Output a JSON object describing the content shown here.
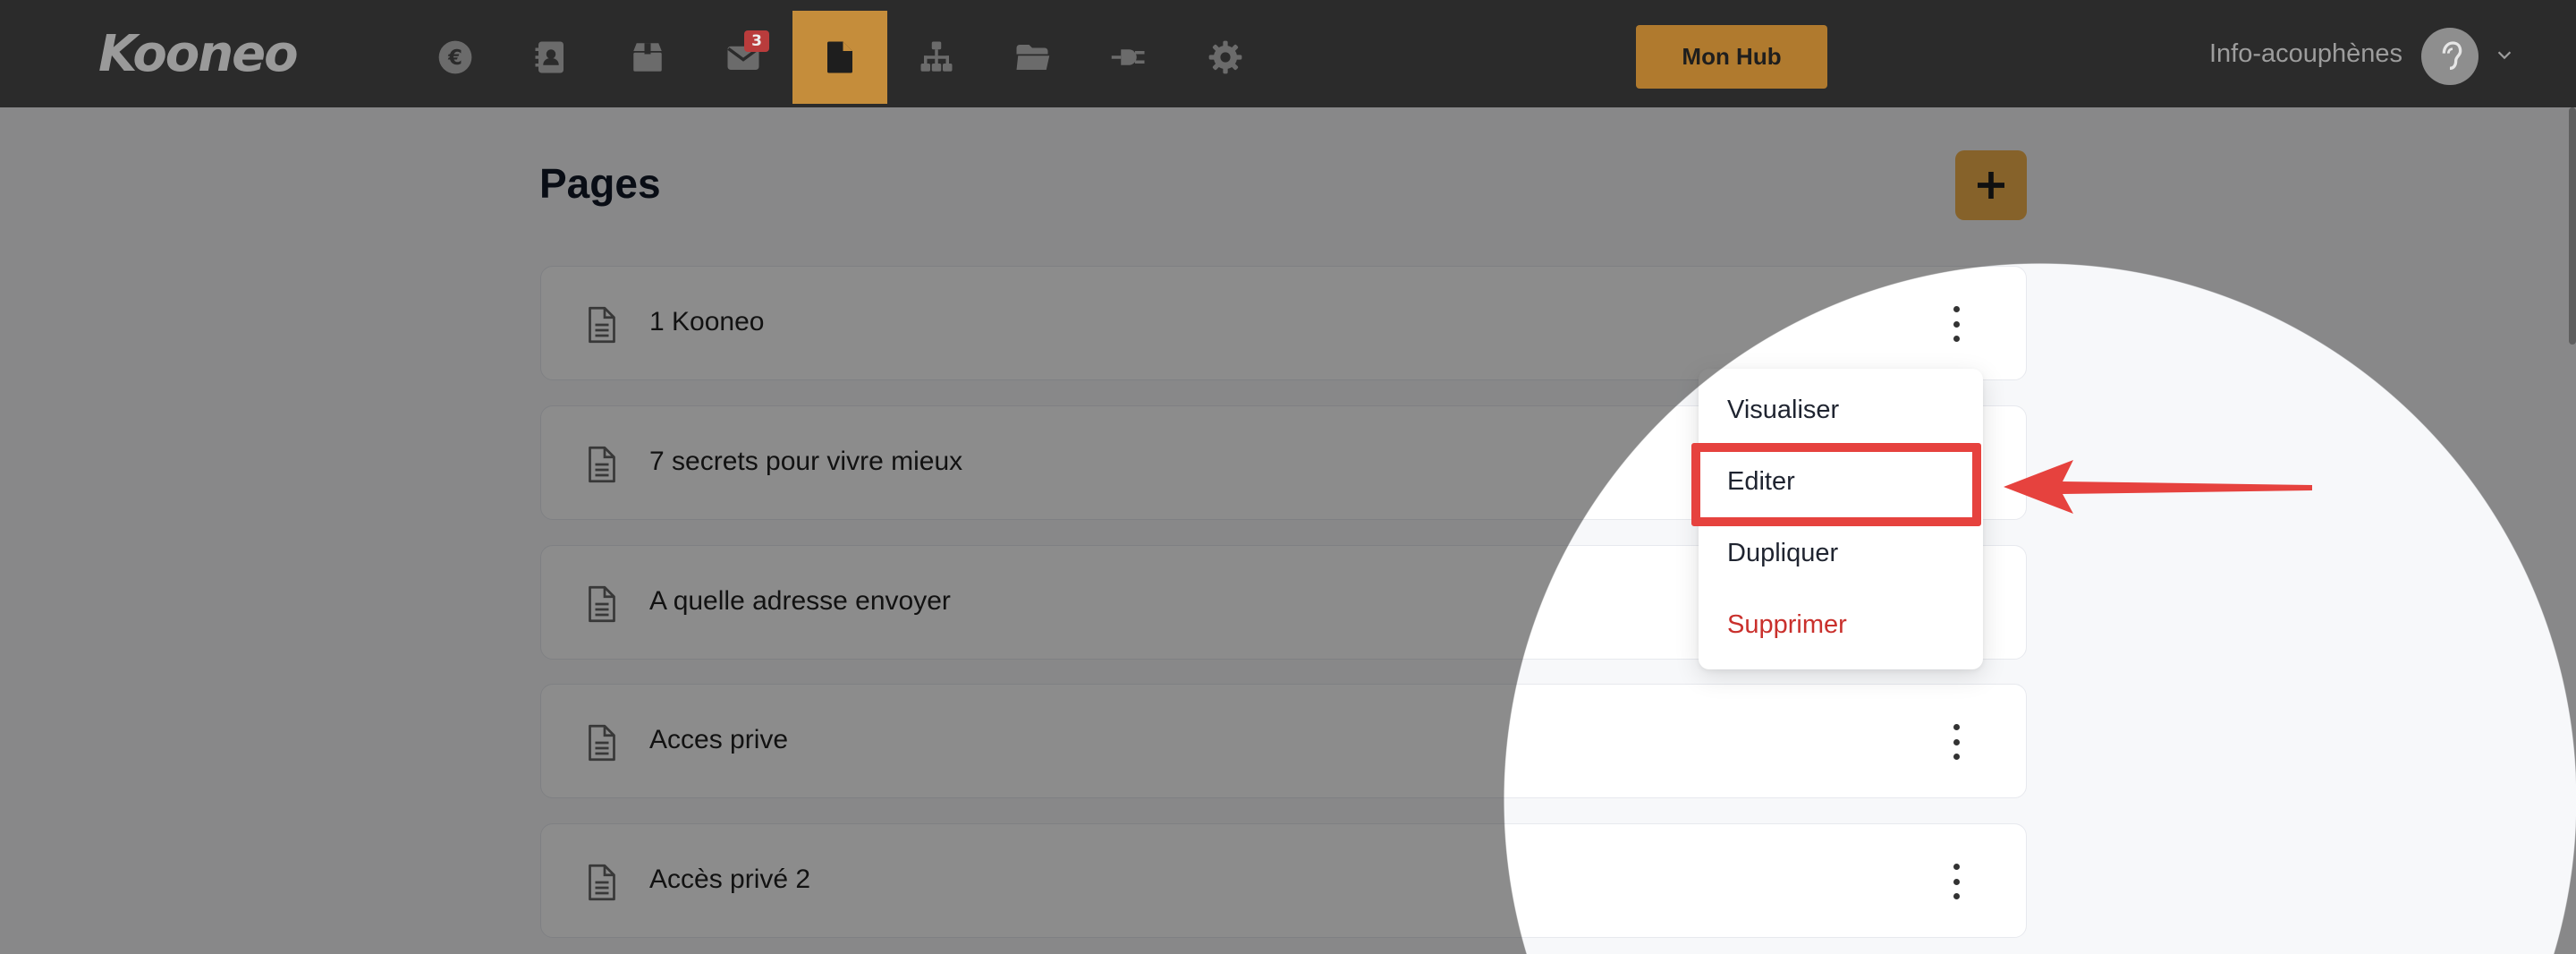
{
  "brand": {
    "logo_text": "Kooneo"
  },
  "nav": {
    "items": [
      {
        "icon": "euro-icon",
        "label": "Ventes"
      },
      {
        "icon": "contacts-icon",
        "label": "Contacts"
      },
      {
        "icon": "products-box-icon",
        "label": "Produits"
      },
      {
        "icon": "mail-icon",
        "label": "Emails",
        "badge": "3"
      },
      {
        "icon": "page-icon",
        "label": "Pages",
        "active": true
      },
      {
        "icon": "sitemap-icon",
        "label": "Tunnels"
      },
      {
        "icon": "folder-icon",
        "label": "Fichiers"
      },
      {
        "icon": "plug-icon",
        "label": "Intégrations"
      },
      {
        "icon": "gear-icon",
        "label": "Paramètres"
      }
    ],
    "hub_button": "Mon Hub",
    "user_name": "Info-acouphènes"
  },
  "page": {
    "title": "Pages",
    "add_button": "+"
  },
  "pages": [
    {
      "label": "1 Kooneo"
    },
    {
      "label": "7 secrets pour vivre mieux"
    },
    {
      "label": "A quelle adresse envoyer"
    },
    {
      "label": "Acces prive"
    },
    {
      "label": "Accès privé 2"
    }
  ],
  "context_menu": {
    "items": [
      {
        "label": "Visualiser"
      },
      {
        "label": "Editer",
        "highlighted": true
      },
      {
        "label": "Dupliquer"
      },
      {
        "label": "Supprimer",
        "danger": true
      }
    ]
  },
  "colors": {
    "nav_bg": "#2b2b2b",
    "accent": "#f4b24e",
    "active_tab": "#c58d3b",
    "hub_button": "#b07a2e",
    "highlight": "#e6423e",
    "danger_text": "#c9302c",
    "badge": "#b93c3c"
  }
}
